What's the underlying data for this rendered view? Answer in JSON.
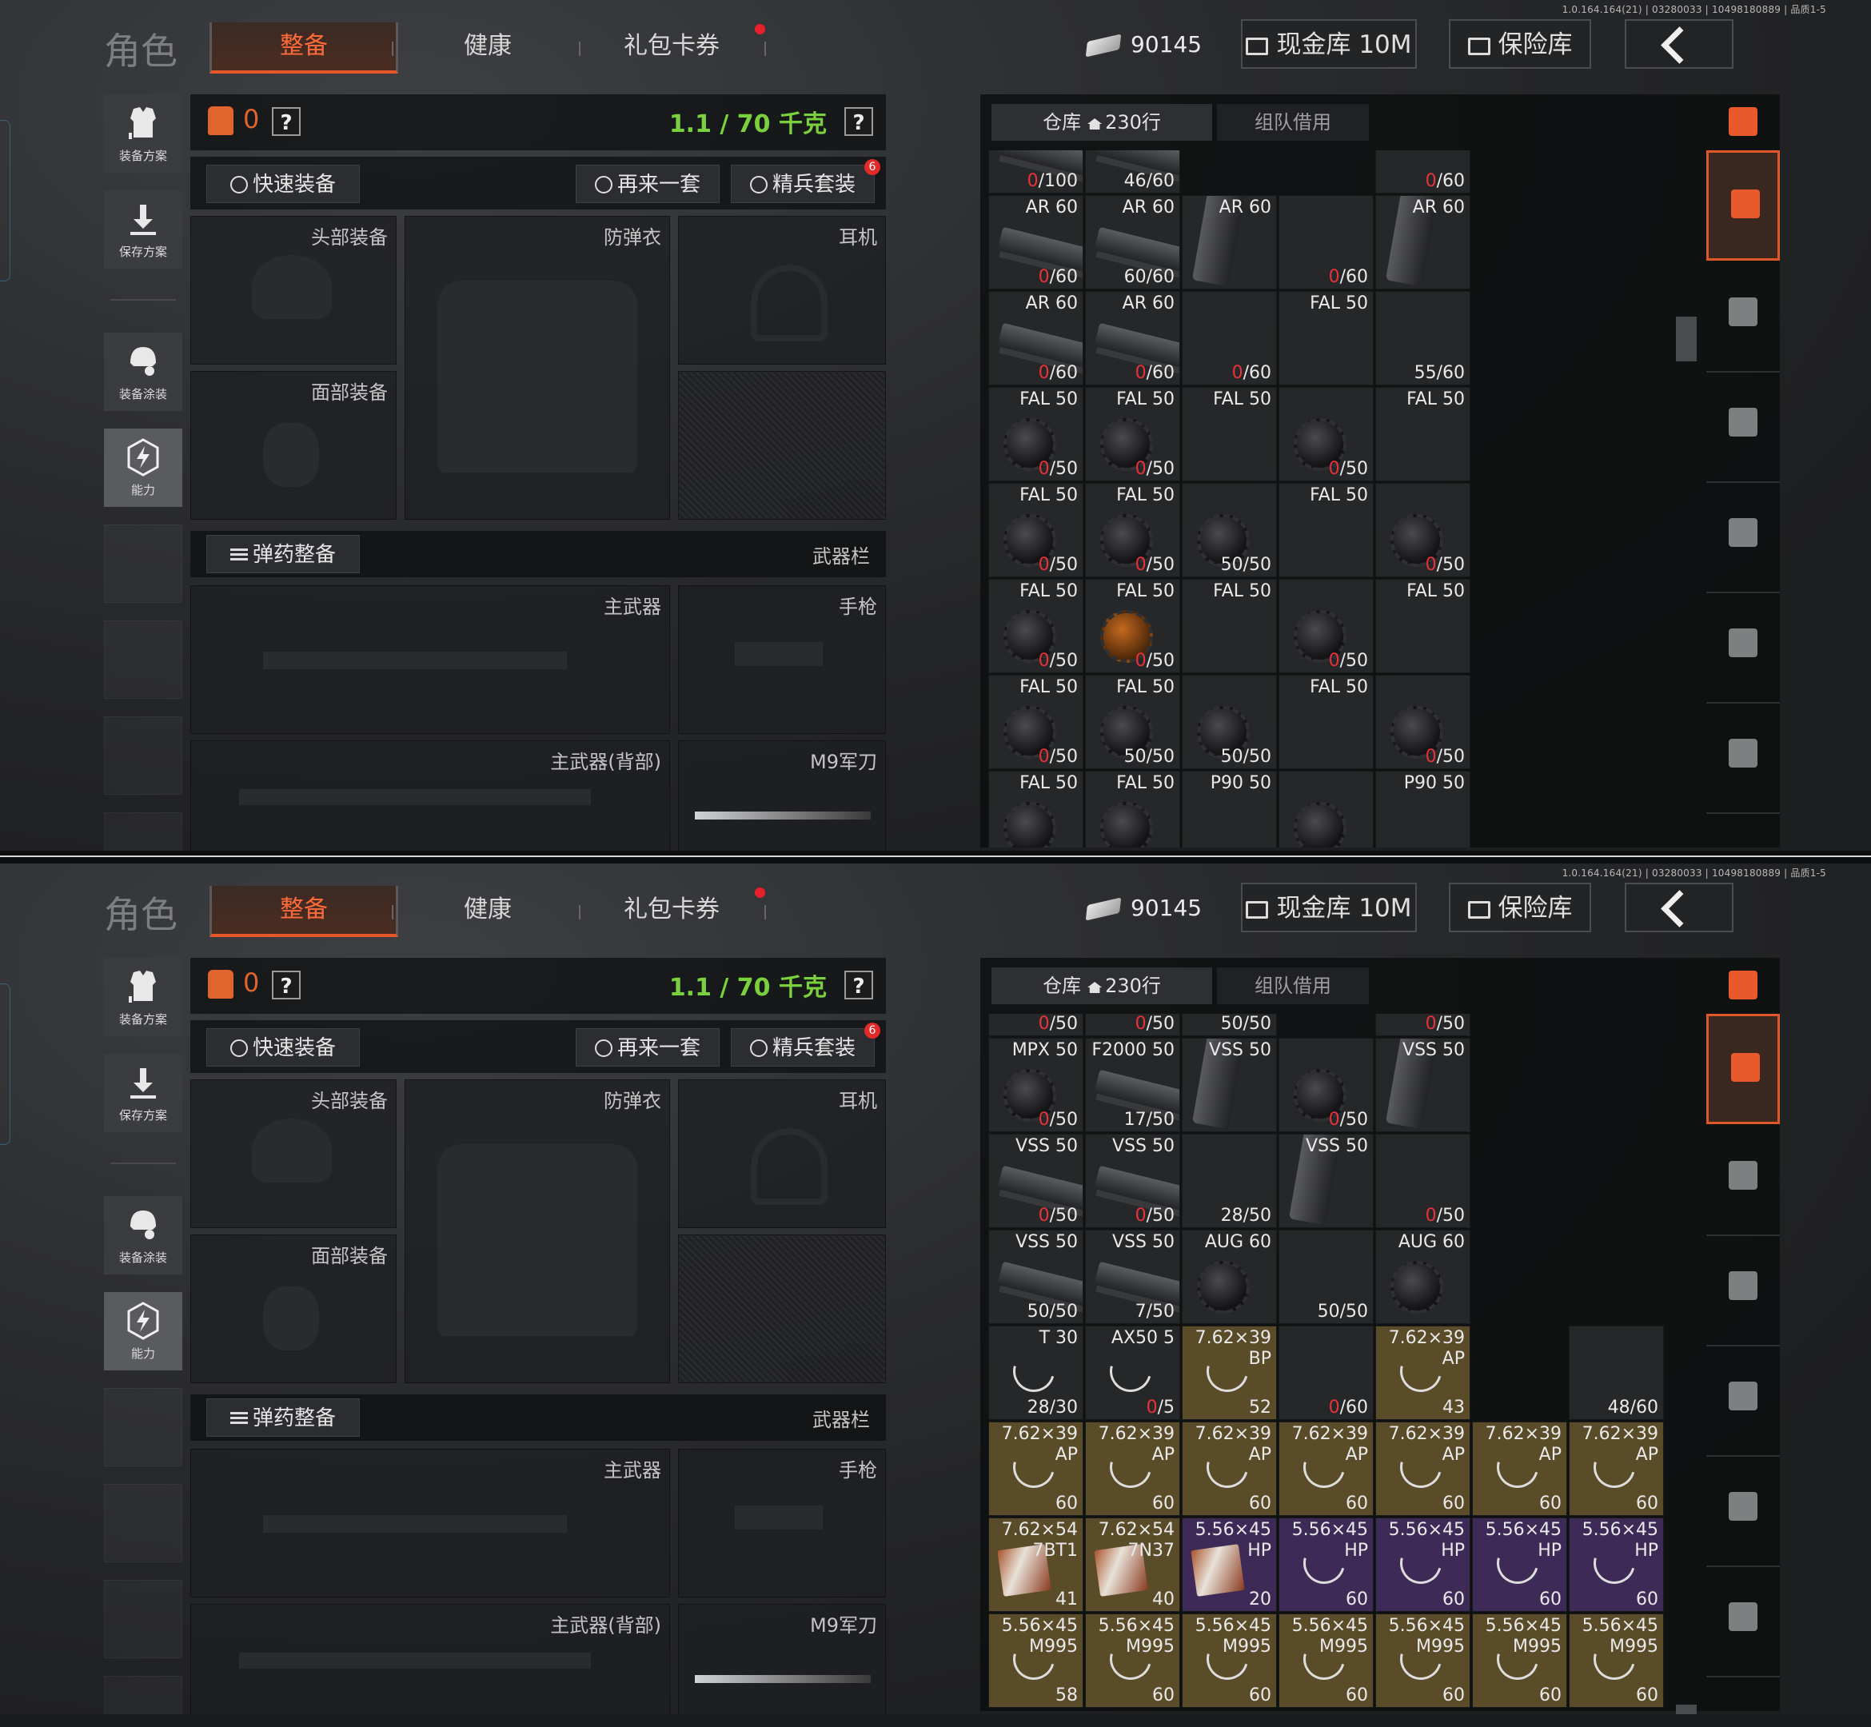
{
  "screens": [
    {
      "version": "1.0.164.164(21) | 03280033 | 10498180889 | 品质1-5",
      "role_title": "角色",
      "tabs": [
        "整备",
        "健康",
        "礼包卡券"
      ],
      "currency": "90145",
      "cash_store": "现金库 10M",
      "safe": "保险库",
      "nav": [
        "装备方案",
        "保存方案",
        "装备涂装",
        "能力"
      ],
      "armor": "0",
      "weight": "1.1 / 70 千克",
      "help": "?",
      "quick_equip": "快速装备",
      "again": "再来一套",
      "elite": "精兵套装",
      "elite_badge": "6",
      "slots": {
        "head": "头部装备",
        "vest": "防弹衣",
        "ear": "耳机",
        "face": "面部装备",
        "primary": "主武器",
        "pistol": "手枪",
        "primary_back": "主武器(背部)",
        "knife": "M9军刀"
      },
      "ammo_btn": "弹药整备",
      "weapon_bar": "武器栏",
      "store_tabs": [
        "仓库",
        "230行",
        "组队借用"
      ],
      "grid": [
        [
          {
            "n": "",
            "c": "0/100",
            "r": "0",
            "t": "mag"
          },
          {
            "n": "",
            "c": "46/60",
            "t": "mag"
          },
          {
            "n": "",
            "c": "",
            "t": ""
          },
          {
            "n": "",
            "c": "",
            "t": ""
          },
          {
            "n": "",
            "c": "0/60",
            "r": "0",
            "t": ""
          }
        ],
        [
          {
            "n": "AR 60",
            "c": "0/60",
            "r": "0",
            "t": "mag"
          },
          {
            "n": "AR 60",
            "c": "60/60",
            "t": "mag"
          },
          {
            "n": "AR 60",
            "c": "",
            "t": "vmag"
          },
          {
            "n": "",
            "c": "0/60",
            "r": "0",
            "t": ""
          },
          {
            "n": "AR 60",
            "c": "",
            "t": "vmag"
          }
        ],
        [
          {
            "n": "AR 60",
            "c": "0/60",
            "r": "0",
            "t": "mag"
          },
          {
            "n": "AR 60",
            "c": "0/60",
            "r": "0",
            "t": "mag"
          },
          {
            "n": "",
            "c": "0/60",
            "r": "0",
            "t": ""
          },
          {
            "n": "FAL 50",
            "c": "",
            "t": ""
          },
          {
            "n": "",
            "c": "55/60",
            "t": ""
          }
        ],
        [
          {
            "n": "FAL 50",
            "c": "0/50",
            "r": "0",
            "t": "drum"
          },
          {
            "n": "FAL 50",
            "c": "0/50",
            "r": "0",
            "t": "drum"
          },
          {
            "n": "FAL 50",
            "c": "",
            "t": ""
          },
          {
            "n": "",
            "c": "0/50",
            "r": "0",
            "t": "drum"
          },
          {
            "n": "FAL 50",
            "c": "",
            "t": ""
          }
        ],
        [
          {
            "n": "FAL 50",
            "c": "0/50",
            "r": "0",
            "t": "drum"
          },
          {
            "n": "FAL 50",
            "c": "0/50",
            "r": "0",
            "t": "drum"
          },
          {
            "n": "",
            "c": "50/50",
            "t": "drum"
          },
          {
            "n": "FAL 50",
            "c": "",
            "t": ""
          },
          {
            "n": "",
            "c": "0/50",
            "r": "0",
            "t": "drum"
          }
        ],
        [
          {
            "n": "FAL 50",
            "c": "0/50",
            "r": "0",
            "t": "drum"
          },
          {
            "n": "FAL 50",
            "c": "0/50",
            "r": "0",
            "t": "drumo"
          },
          {
            "n": "FAL 50",
            "c": "",
            "t": ""
          },
          {
            "n": "",
            "c": "0/50",
            "r": "0",
            "t": "drum"
          },
          {
            "n": "FAL 50",
            "c": "",
            "t": ""
          }
        ],
        [
          {
            "n": "FAL 50",
            "c": "0/50",
            "r": "0",
            "t": "drum"
          },
          {
            "n": "FAL 50",
            "c": "50/50",
            "t": "drum"
          },
          {
            "n": "",
            "c": "50/50",
            "t": "drum"
          },
          {
            "n": "FAL 50",
            "c": "",
            "t": ""
          },
          {
            "n": "",
            "c": "0/50",
            "r": "0",
            "t": "drum"
          }
        ],
        [
          {
            "n": "FAL 50",
            "c": "",
            "t": "drum"
          },
          {
            "n": "FAL 50",
            "c": "",
            "t": "drum"
          },
          {
            "n": "P90 50",
            "c": "",
            "t": ""
          },
          {
            "n": "",
            "c": "",
            "t": "drum"
          },
          {
            "n": "P90 50",
            "c": "",
            "t": ""
          }
        ]
      ]
    },
    {
      "version": "1.0.164.164(21) | 03280033 | 10498180889 | 品质1-5",
      "role_title": "角色",
      "tabs": [
        "整备",
        "健康",
        "礼包卡券"
      ],
      "currency": "90145",
      "cash_store": "现金库 10M",
      "safe": "保险库",
      "nav": [
        "装备方案",
        "保存方案",
        "装备涂装",
        "能力"
      ],
      "armor": "0",
      "weight": "1.1 / 70 千克",
      "help": "?",
      "quick_equip": "快速装备",
      "again": "再来一套",
      "elite": "精兵套装",
      "elite_badge": "6",
      "slots": {
        "head": "头部装备",
        "vest": "防弹衣",
        "ear": "耳机",
        "face": "面部装备",
        "primary": "主武器",
        "pistol": "手枪",
        "primary_back": "主武器(背部)",
        "knife": "M9军刀"
      },
      "ammo_btn": "弹药整备",
      "weapon_bar": "武器栏",
      "store_tabs": [
        "仓库",
        "230行",
        "组队借用"
      ],
      "grid": [
        [
          {
            "n": "",
            "c": "0/50",
            "r": "0",
            "t": ""
          },
          {
            "n": "",
            "c": "0/50",
            "r": "0",
            "t": ""
          },
          {
            "n": "",
            "c": "50/50",
            "t": ""
          },
          {
            "n": "",
            "c": "",
            "t": ""
          },
          {
            "n": "",
            "c": "0/50",
            "r": "0",
            "t": ""
          }
        ],
        [
          {
            "n": "MPX 50",
            "c": "0/50",
            "r": "0",
            "t": "drum"
          },
          {
            "n": "F2000 50",
            "c": "17/50",
            "t": "mag"
          },
          {
            "n": "VSS 50",
            "c": "",
            "t": "vmag"
          },
          {
            "n": "",
            "c": "0/50",
            "r": "0",
            "t": "drum"
          },
          {
            "n": "VSS 50",
            "c": "",
            "t": "vmag"
          }
        ],
        [
          {
            "n": "VSS 50",
            "c": "0/50",
            "r": "0",
            "t": "mag"
          },
          {
            "n": "VSS 50",
            "c": "0/50",
            "r": "0",
            "t": "mag"
          },
          {
            "n": "",
            "c": "28/50",
            "t": ""
          },
          {
            "n": "VSS 50",
            "c": "",
            "t": "vmag"
          },
          {
            "n": "",
            "c": "0/50",
            "r": "0",
            "t": ""
          }
        ],
        [
          {
            "n": "VSS 50",
            "c": "50/50",
            "t": "mag"
          },
          {
            "n": "VSS 50",
            "c": "7/50",
            "t": "mag"
          },
          {
            "n": "AUG 60",
            "c": "",
            "t": "drum"
          },
          {
            "n": "",
            "c": "50/50",
            "t": ""
          },
          {
            "n": "AUG 60",
            "c": "",
            "t": "drum"
          }
        ],
        [
          {
            "n": "T 30",
            "c": "28/30",
            "t": "ring"
          },
          {
            "n": "AX50 5",
            "c": "0/5",
            "r": "0",
            "t": "ring"
          },
          {
            "n": "7.62×39 BP",
            "c": "52",
            "t": "ring",
            "g": "gold"
          },
          {
            "n": "",
            "c": "0/60",
            "r": "0",
            "t": ""
          },
          {
            "n": "7.62×39 AP",
            "c": "43",
            "t": "ring",
            "g": "gold"
          },
          {
            "n": "",
            "c": "",
            "t": ""
          },
          {
            "n": "",
            "c": "48/60",
            "t": ""
          }
        ],
        [
          {
            "n": "7.62×39 AP",
            "c": "60",
            "t": "ring",
            "g": "gold"
          },
          {
            "n": "7.62×39 AP",
            "c": "60",
            "t": "ring",
            "g": "gold"
          },
          {
            "n": "7.62×39 AP",
            "c": "60",
            "t": "ring",
            "g": "gold"
          },
          {
            "n": "7.62×39 AP",
            "c": "60",
            "t": "ring",
            "g": "gold"
          },
          {
            "n": "7.62×39 AP",
            "c": "60",
            "t": "ring",
            "g": "gold"
          },
          {
            "n": "7.62×39 AP",
            "c": "60",
            "t": "ring",
            "g": "gold"
          },
          {
            "n": "7.62×39 AP",
            "c": "60",
            "t": "ring",
            "g": "gold"
          }
        ],
        [
          {
            "n": "7.62×54 7BT1",
            "c": "41",
            "t": "shell",
            "g": "gold"
          },
          {
            "n": "7.62×54 7N37",
            "c": "40",
            "t": "shell",
            "g": "gold"
          },
          {
            "n": "5.56×45 HP",
            "c": "20",
            "t": "shell",
            "g": "purple"
          },
          {
            "n": "5.56×45 HP",
            "c": "60",
            "t": "ring",
            "g": "purple"
          },
          {
            "n": "5.56×45 HP",
            "c": "60",
            "t": "ring",
            "g": "purple"
          },
          {
            "n": "5.56×45 HP",
            "c": "60",
            "t": "ring",
            "g": "purple"
          },
          {
            "n": "5.56×45 HP",
            "c": "60",
            "t": "ring",
            "g": "purple"
          }
        ],
        [
          {
            "n": "5.56×45 M995",
            "c": "58",
            "t": "ring",
            "g": "gold"
          },
          {
            "n": "5.56×45 M995",
            "c": "60",
            "t": "ring",
            "g": "gold"
          },
          {
            "n": "5.56×45 M995",
            "c": "60",
            "t": "ring",
            "g": "gold"
          },
          {
            "n": "5.56×45 M995",
            "c": "60",
            "t": "ring",
            "g": "gold"
          },
          {
            "n": "5.56×45 M995",
            "c": "60",
            "t": "ring",
            "g": "gold"
          },
          {
            "n": "5.56×45 M995",
            "c": "60",
            "t": "ring",
            "g": "gold"
          },
          {
            "n": "5.56×45 M995",
            "c": "60",
            "t": "ring",
            "g": "gold"
          }
        ]
      ]
    }
  ]
}
